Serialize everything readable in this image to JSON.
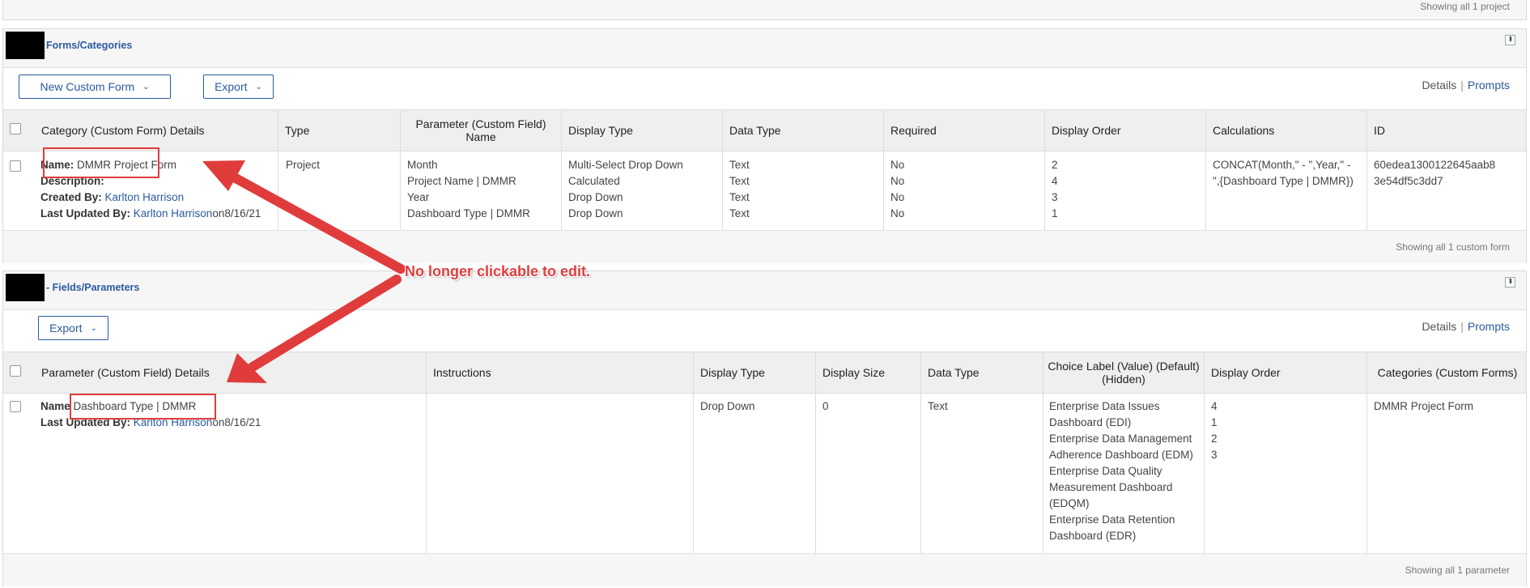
{
  "top_panel": {
    "footer": "Showing all 1 project"
  },
  "forms_panel": {
    "title": "Forms/Categories",
    "new_form_button": "New Custom Form",
    "export_button": "Export",
    "details_link": "Details",
    "prompts_link": "Prompts",
    "columns": [
      "Category (Custom Form) Details",
      "Type",
      "Parameter (Custom Field) Name",
      "Display Type",
      "Data Type",
      "Required",
      "Display Order",
      "Calculations",
      "ID"
    ],
    "row": {
      "name_label": "Name:",
      "name_value": "DMMR Project Form",
      "description_label": "Description:",
      "created_by_label": "Created By:",
      "created_by_value": "Karlton Harrison",
      "updated_by_label": "Last Updated By:",
      "updated_by_value": "Karlton Harrison",
      "updated_on": "on8/16/21",
      "type": "Project",
      "parameters": [
        "Month",
        "Project Name | DMMR",
        "Year",
        "Dashboard Type | DMMR"
      ],
      "display_types": [
        "Multi-Select Drop Down",
        "Calculated",
        "Drop Down",
        "Drop Down"
      ],
      "data_types": [
        "Text",
        "Text",
        "Text",
        "Text"
      ],
      "required": [
        "No",
        "No",
        "No",
        "No"
      ],
      "display_order": [
        "2",
        "4",
        "3",
        "1"
      ],
      "calculations": [
        "CONCAT(Month,\" - \",Year,\" -",
        "\",{Dashboard Type | DMMR})"
      ],
      "id": [
        "60edea1300122645aab8",
        "3e54df5c3dd7"
      ]
    },
    "footer": "Showing all 1 custom form"
  },
  "fields_panel": {
    "title": "- Fields/Parameters",
    "export_button": "Export",
    "details_link": "Details",
    "prompts_link": "Prompts",
    "columns": [
      "Parameter (Custom Field) Details",
      "Instructions",
      "Display Type",
      "Display Size",
      "Data Type",
      "Choice Label (Value) (Default) (Hidden)",
      "Display Order",
      "Categories (Custom Forms)"
    ],
    "row": {
      "name_label": "Name",
      "name_value": "Dashboard Type | DMMR",
      "updated_by_label": "Last Updated By:",
      "updated_by_value": "Karlton Harrison",
      "updated_on": "on8/16/21",
      "display_type": "Drop Down",
      "display_size": "0",
      "data_type": "Text",
      "choices": [
        "Enterprise Data Issues",
        "Dashboard (EDI)",
        "Enterprise Data Management",
        "Adherence Dashboard (EDM)",
        "Enterprise Data Quality",
        "Measurement Dashboard",
        "(EDQM)",
        "Enterprise Data Retention",
        "Dashboard (EDR)"
      ],
      "display_order": [
        "4",
        "1",
        "2",
        "3"
      ],
      "categories": "DMMR Project Form"
    },
    "footer": "Showing all 1 parameter"
  },
  "annotation": {
    "text": "No longer clickable to edit.",
    "color": "#e03c3c"
  }
}
